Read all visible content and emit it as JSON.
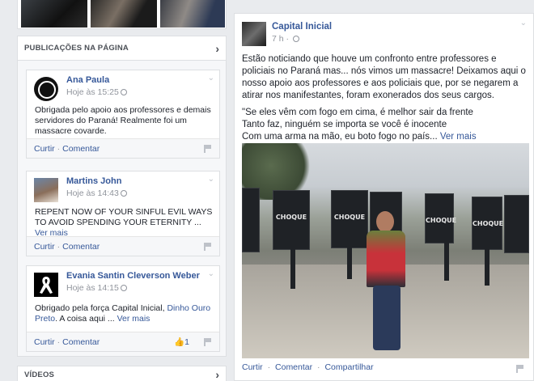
{
  "left": {
    "publications_title": "PUBLICAÇÕES NA PÁGINA",
    "videos_title": "VÍDEOS",
    "posts": [
      {
        "author": "Ana Paula",
        "time": "Hoje às 15:25",
        "text": "Obrigada pelo apoio aos professores e demais servidores do Paraná! Realmente foi um massacre covarde.",
        "see_more": "",
        "likes": ""
      },
      {
        "author": "Martins John",
        "time": "Hoje às 14:43",
        "text": "REPENT NOW OF YOUR SINFUL EVIL WAYS TO AVOID SPENDING YOUR ETERNITY ...",
        "see_more": "Ver mais",
        "likes": ""
      },
      {
        "author": "Evania Santin Cleverson Weber",
        "time": "Hoje às 14:15",
        "text": "Obrigado pela força Capital Inicial,",
        "mention": "Dinho Ouro Preto",
        "text2": ". A coisa aqui ...",
        "see_more": "Ver mais",
        "likes": "1"
      }
    ],
    "actions": {
      "like": "Curtir",
      "comment": "Comentar"
    }
  },
  "post": {
    "author": "Capital Inicial",
    "time": "7 h",
    "paragraph1": "Estão noticiando que houve um confronto entre professores e policiais no Paraná mas... nós vimos um massacre! Deixamos aqui o nosso apoio aos professores e aos policiais que, por se negarem a atirar nos manifestantes, foram exonerados dos seus cargos.",
    "lyric1": "\"Se eles vêm com fogo em cima, é melhor sair da frente",
    "lyric2": "Tanto faz, ninguém se importa se você é inocente",
    "lyric3": "Com uma arma na mão, eu boto fogo no país...",
    "see_more": "Ver mais",
    "shield_text": "CHOQUE",
    "actions": {
      "like": "Curtir",
      "comment": "Comentar",
      "share": "Compartilhar"
    }
  }
}
